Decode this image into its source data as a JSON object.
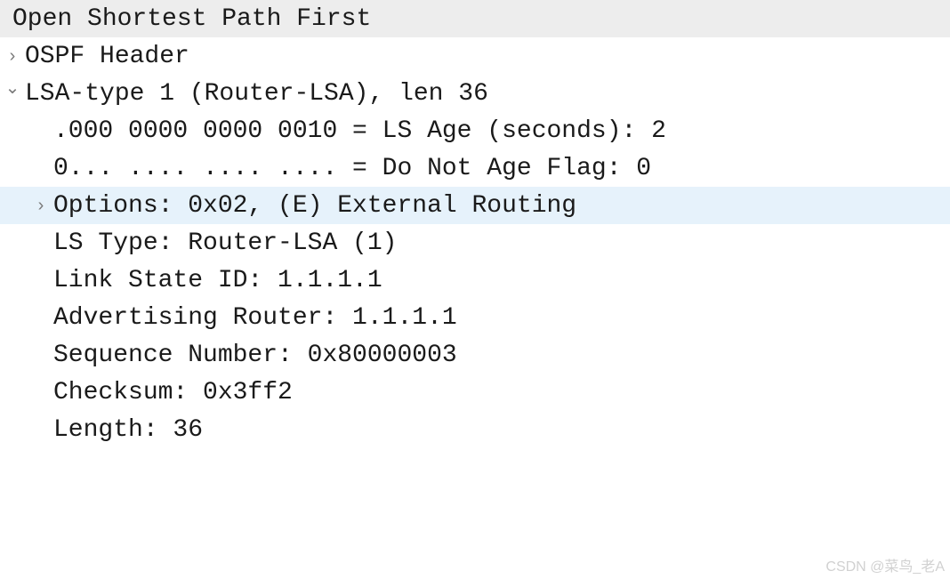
{
  "protocol_title": "Open Shortest Path First",
  "nodes": {
    "ospf_header": "OSPF Header",
    "lsa_type_header": "LSA-type 1 (Router-LSA), len 36",
    "ls_age": ".000 0000 0000 0010 = LS Age (seconds): 2",
    "do_not_age": "0... .... .... .... = Do Not Age Flag: 0",
    "options": "Options: 0x02, (E) External Routing",
    "ls_type": "LS Type: Router-LSA (1)",
    "link_state_id": "Link State ID: 1.1.1.1",
    "advertising_router": "Advertising Router: 1.1.1.1",
    "sequence_number": "Sequence Number: 0x80000003",
    "checksum": "Checksum: 0x3ff2",
    "length": "Length: 36"
  },
  "watermark": "CSDN @菜鸟_老A"
}
